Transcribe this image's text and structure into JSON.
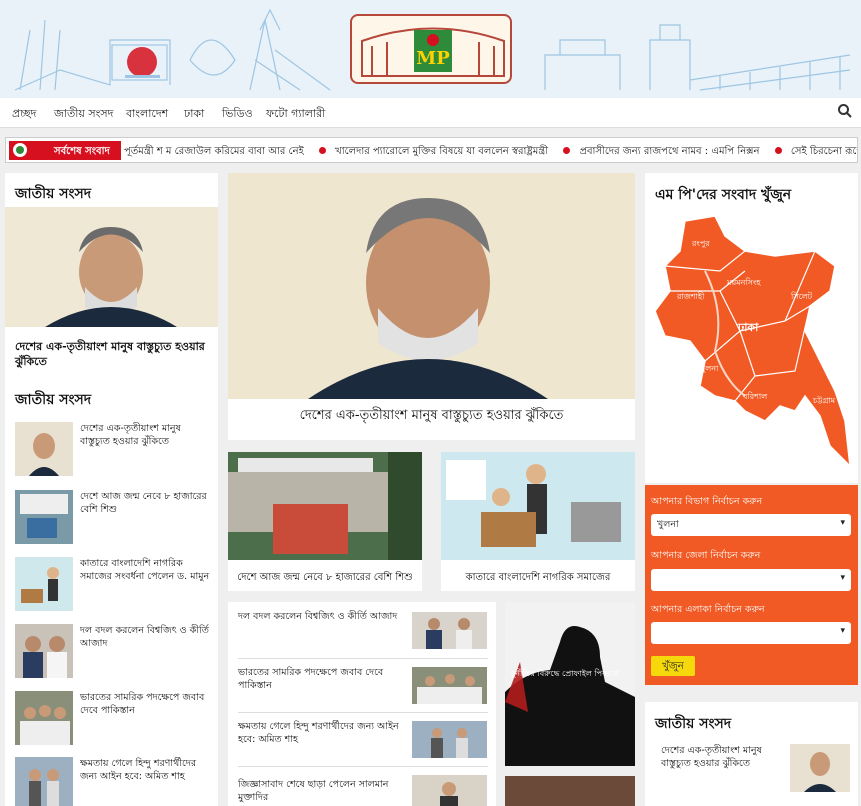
{
  "nav": {
    "items": [
      "প্রচ্ছদ",
      "জাতীয় সংসদ",
      "বাংলাদেশ",
      "ঢাকা",
      "ভিডিও",
      "ফটো গ্যালারী"
    ],
    "search_icon": "search-icon"
  },
  "logo": {
    "text": "MP"
  },
  "ticker": {
    "label": "সর্বশেষ সংবাদ",
    "items": [
      "পূর্তমন্ত্রী শ ম রেজাউল করিমের বাবা আর নেই",
      "খালেদার প্যারোলে মুক্তির বিষয়ে যা বললেন স্বরাষ্ট্রমন্ত্রী",
      "প্রবাসীদের জন্য রাজপথে নামব : এমপি নিক্সন",
      "সেই চিরচেনা রূপে ওবায়দুল কাদের"
    ]
  },
  "left": {
    "section_title": "জাতীয় সংসদ",
    "lead_caption": "দেশের এক-তৃতীয়াংশ মানুষ বাস্তুচ্যুত হওয়ার ঝুঁকিতে",
    "list_title": "জাতীয় সংসদ",
    "list": [
      "দেশের এক-তৃতীয়াংশ মানুষ বাস্তুচ্যুত হওয়ার ঝুঁকিতে",
      "দেশে আজ জন্ম নেবে ৮ হাজারের বেশি শিশু",
      "কাতারে বাংলাদেশি নাগরিক সমাজের সংবর্ধনা পেলেন ড. মামুন",
      "দল বদল করলেন বিশ্বজিৎ ও কীর্তি আজাদ",
      "ভারতের সামরিক পদক্ষেপে জবাব দেবে পাকিস্তান",
      "ক্ষমতায় গেলে হিন্দু শরণার্থীদের জন্য আইন হবে: অমিত শাহ"
    ]
  },
  "center": {
    "lead_caption": "দেশের এক-তৃতীয়াংশ মানুষ বাস্তুচ্যুত হওয়ার ঝুঁকিতে",
    "card1": "দেশে আজ জন্ম নেবে ৮ হাজারের বেশি শিশু",
    "card2": "কাতারে বাংলাদেশি নাগরিক সমাজের",
    "list": [
      "দল বদল করলেন বিশ্বজিৎ ও কীর্তি আজাদ",
      "ভারতের সামরিক পদক্ষেপে জবাব দেবে পাকিস্তান",
      "ক্ষমতায় গেলে হিন্দু শরণার্থীদের জন্য আইন হবে: অমিত শাহ",
      "জিজ্ঞাসাবাদ শেষে ছাড়া পেলেন সালমান মুক্তাদির"
    ],
    "poster_text": "দুর্নীতির বিরুদ্ধে প্রোফাইল পিকচার"
  },
  "right": {
    "map_title": "এম পি'দের সংবাদ খুঁজুন",
    "divisions": [
      "রংপুর",
      "রাজশাহী",
      "ময়মনসিংহ",
      "সিলেট",
      "ঢাকা",
      "খুলনা",
      "বরিশাল",
      "চট্টগ্রাম"
    ],
    "form": {
      "division_label": "আপনার বিভাগ নির্বাচন করুন",
      "division_value": "খুলনা",
      "district_label": "আপনার জেলা নির্বাচন করুন",
      "district_value": "",
      "area_label": "আপনার এলাকা নির্বাচন করুন",
      "area_value": "",
      "button": "খুঁজুন"
    },
    "parliament_title": "জাতীয় সংসদ",
    "parliament_item": "দেশের এক-তৃতীয়াংশ মানুষ বাস্তুচ্যুত হওয়ার ঝুঁকিতে"
  },
  "colors": {
    "accent": "#d6101f",
    "map": "#f15a24",
    "button": "#f5d90a"
  }
}
